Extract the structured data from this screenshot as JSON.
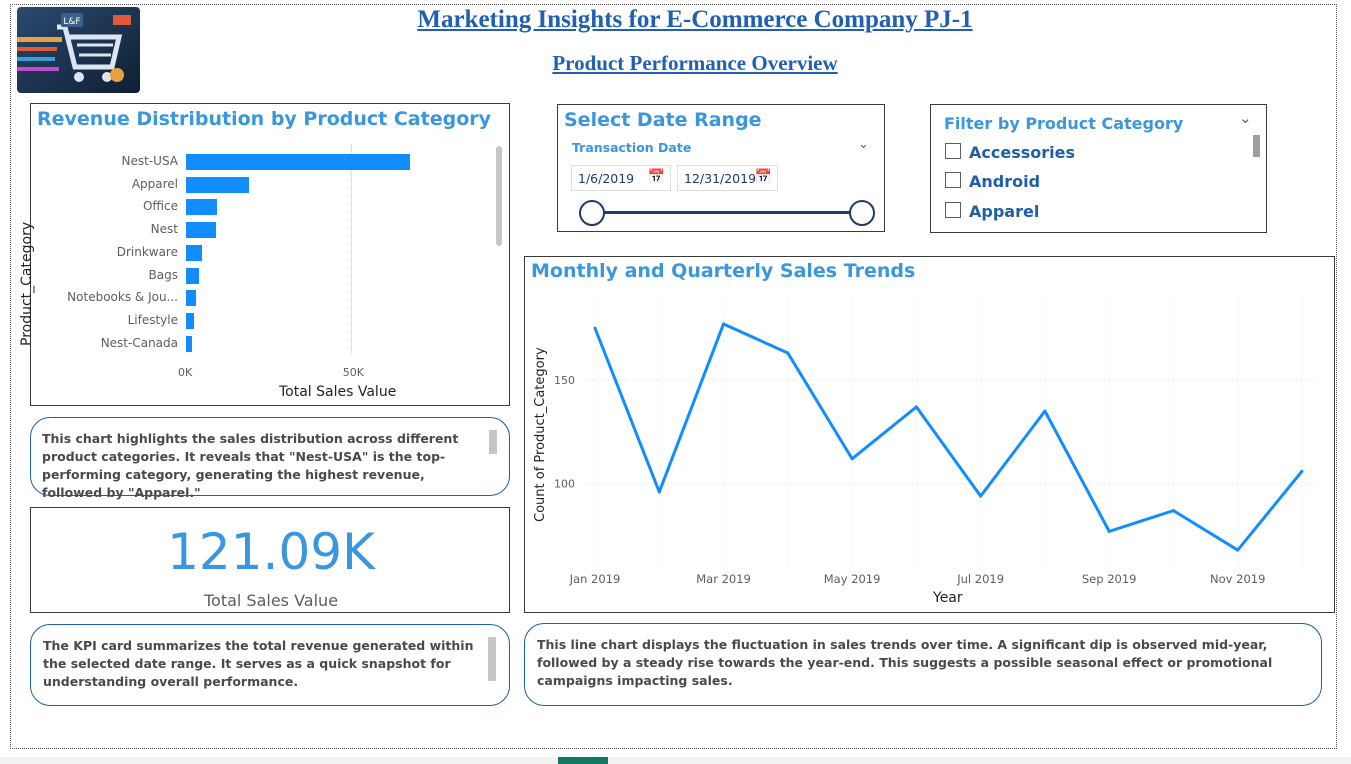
{
  "header": {
    "title": "Marketing Insights for E-Commerce Company PJ-1",
    "subtitle": "Product Performance Overview",
    "logo_text": "L&F"
  },
  "revenue_chart": {
    "title": "Revenue Distribution by Product Category",
    "chart_data": {
      "type": "bar",
      "orientation": "horizontal",
      "categories": [
        "Nest-USA",
        "Apparel",
        "Office",
        "Nest",
        "Drinkware",
        "Bags",
        "Notebooks & Jou...",
        "Lifestyle",
        "Nest-Canada"
      ],
      "values": [
        68000,
        19000,
        9500,
        9000,
        5000,
        4000,
        3000,
        2500,
        1700
      ],
      "xlabel": "Total Sales Value",
      "ylabel": "Product_Category",
      "xticks": [
        "0K",
        "50K"
      ],
      "xlim": [
        0,
        85000
      ]
    }
  },
  "date_slicer": {
    "title": "Select Date Range",
    "field_label": "Transaction Date",
    "start_date": "1/6/2019",
    "end_date": "12/31/2019"
  },
  "category_filter": {
    "title": "Filter by Product Category",
    "options": [
      "Accessories",
      "Android",
      "Apparel"
    ]
  },
  "trend_chart": {
    "title": "Monthly and Quarterly Sales Trends",
    "chart_data": {
      "type": "line",
      "x": [
        "2019-01",
        "2019-02",
        "2019-03",
        "2019-04",
        "2019-05",
        "2019-06",
        "2019-07",
        "2019-08",
        "2019-09",
        "2019-10",
        "2019-11",
        "2019-12"
      ],
      "y": [
        175,
        96,
        177,
        163,
        112,
        137,
        94,
        135,
        77,
        87,
        68,
        106
      ],
      "xlabel": "Year",
      "ylabel": "Count of Product_Category",
      "xticks": [
        "Jan 2019",
        "Mar 2019",
        "May 2019",
        "Jul 2019",
        "Sep 2019",
        "Nov 2019"
      ],
      "yticks": [
        100,
        150
      ],
      "ylim": [
        55,
        190
      ],
      "color": "#118dff",
      "grid": true
    }
  },
  "notes": {
    "revenue": "This chart highlights the sales distribution across different product categories. It reveals that \"Nest-USA\" is the top-performing category, generating the highest revenue, followed by \"Apparel.\"",
    "kpi": "The KPI card summarizes the total revenue generated within the selected date range. It serves as a quick snapshot for understanding overall performance.",
    "trend": "This line chart displays the fluctuation in sales trends over time. A significant dip is observed mid-year, followed by a steady rise towards the year-end. This suggests a possible seasonal effect or promotional campaigns impacting sales."
  },
  "kpi": {
    "value": "121.09K",
    "label": "Total Sales Value",
    "color": "#3a96dd"
  },
  "icons": [
    "logo-icon",
    "calendar-icon",
    "chevron-down-icon",
    "checkbox-icon",
    "slider-handle-icon"
  ]
}
